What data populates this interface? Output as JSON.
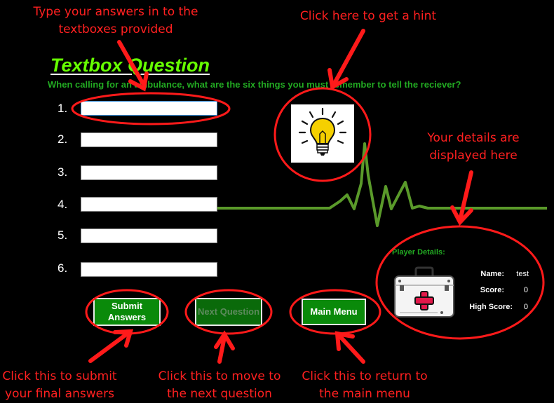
{
  "title": "Textbox Question",
  "question": "When calling for an ambulance, what are the six things you must remember to tell the reciever?",
  "answers": [
    {
      "number": "1.",
      "value": ""
    },
    {
      "number": "2.",
      "value": ""
    },
    {
      "number": "3.",
      "value": ""
    },
    {
      "number": "4.",
      "value": ""
    },
    {
      "number": "5.",
      "value": ""
    },
    {
      "number": "6.",
      "value": ""
    }
  ],
  "buttons": {
    "submit": "Submit Answers",
    "next": "Next Question",
    "main_menu": "Main Menu"
  },
  "player": {
    "heading": "Player Details:",
    "name_label": "Name:",
    "name_value": "test",
    "score_label": "Score:",
    "score_value": "0",
    "high_label": "High Score:",
    "high_value": "0"
  },
  "annotations": {
    "type_answers": "Type your answers in to the textboxes provided",
    "hint": "Click here to get a hint",
    "details": "Your details are displayed here",
    "submit": "Click this to submit your final answers",
    "next": "Click this to move to the next question",
    "menu": "Click this to return to the main menu"
  },
  "icons": {
    "hint": "lightbulb-icon",
    "player": "first-aid-kit-icon"
  },
  "colors": {
    "title": "#66ff00",
    "button": "#0a8a0a",
    "annotation": "#ff2020",
    "heartbeat": "#5a9a2a"
  }
}
